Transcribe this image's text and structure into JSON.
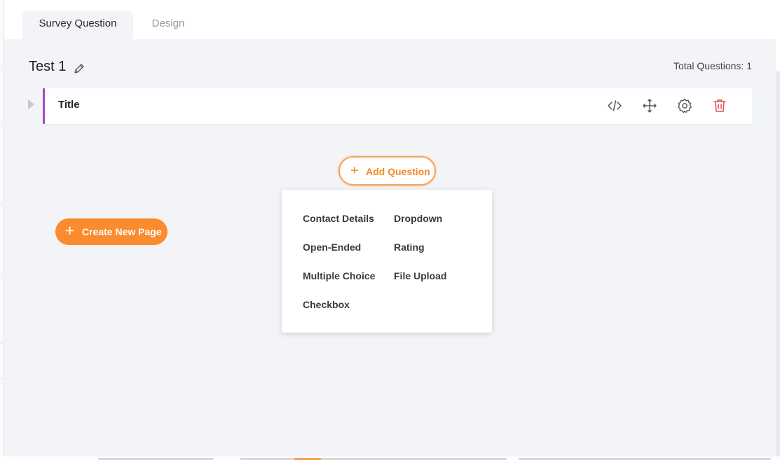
{
  "tabs": [
    {
      "label": "Survey Question",
      "active": true
    },
    {
      "label": "Design",
      "active": false
    }
  ],
  "survey": {
    "title": "Test 1",
    "total_questions": "Total Questions: 1"
  },
  "question": {
    "title": "Title",
    "accent_color": "#a64ac9",
    "actions": [
      "code-icon",
      "move-icon",
      "gear-icon",
      "trash-icon"
    ]
  },
  "add_question": {
    "plus": "+",
    "label": "Add Question",
    "menu": {
      "col1": [
        "Contact Details",
        "Open-Ended",
        "Multiple Choice",
        "Checkbox"
      ],
      "col2": [
        "Dropdown",
        "Rating",
        "File Upload"
      ]
    }
  },
  "create_page": {
    "plus": "+",
    "label": "Create New Page"
  },
  "colors": {
    "accent_orange": "#fa8b2e",
    "delete_red": "#e05252",
    "background": "#f2f4f8"
  }
}
